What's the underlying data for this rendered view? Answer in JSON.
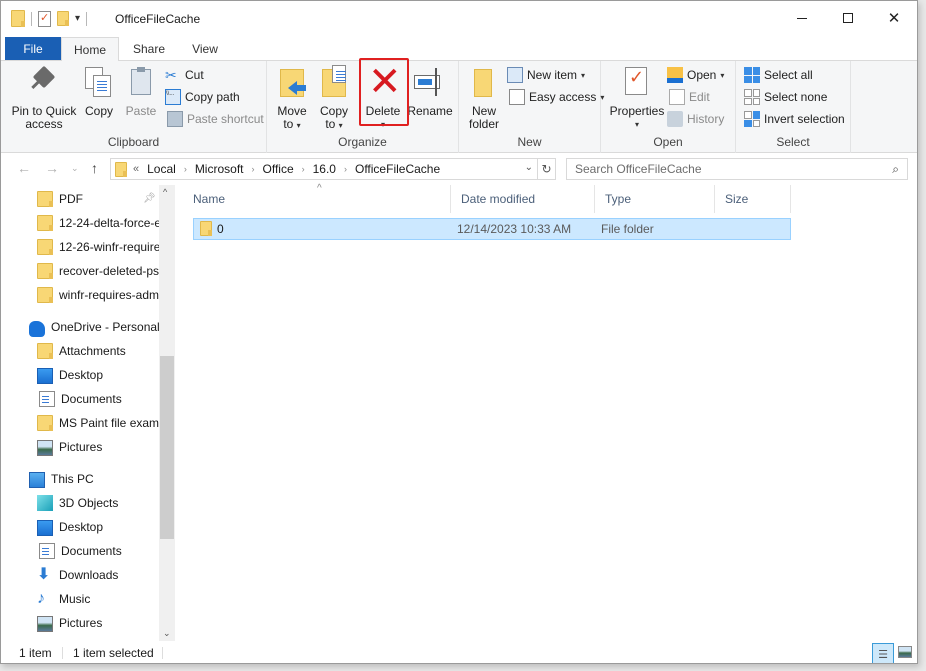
{
  "window": {
    "title": "OfficeFileCache",
    "controls": {
      "minimize": "minimize",
      "maximize": "maximize",
      "close": "✕"
    }
  },
  "tabs": [
    {
      "label": "File"
    },
    {
      "label": "Home"
    },
    {
      "label": "Share"
    },
    {
      "label": "View"
    }
  ],
  "ribbon": {
    "clipboard": {
      "label": "Clipboard",
      "pin": "Pin to Quick access",
      "pin_line1": "Pin to Quick",
      "pin_line2": "access",
      "copy": "Copy",
      "paste": "Paste",
      "cut": "Cut",
      "copy_path": "Copy path",
      "paste_shortcut": "Paste shortcut"
    },
    "organize": {
      "label": "Organize",
      "move_to_line1": "Move",
      "move_to_line2": "to",
      "copy_to_line1": "Copy",
      "copy_to_line2": "to",
      "delete": "Delete",
      "rename": "Rename"
    },
    "new": {
      "label": "New",
      "new_folder_line1": "New",
      "new_folder_line2": "folder",
      "new_item": "New item",
      "easy_access": "Easy access"
    },
    "open": {
      "label": "Open",
      "properties": "Properties",
      "open": "Open",
      "edit": "Edit",
      "history": "History"
    },
    "select": {
      "label": "Select",
      "select_all": "Select all",
      "select_none": "Select none",
      "invert_selection": "Invert selection"
    }
  },
  "address": {
    "overflow": "«",
    "crumbs": [
      "Local",
      "Microsoft",
      "Office",
      "16.0",
      "OfficeFileCache"
    ],
    "search_placeholder": "Search OfficeFileCache"
  },
  "nav_pane": {
    "quick_access": [
      {
        "label": "PDF",
        "pinned": true
      },
      {
        "label": "12-24-delta-force-e"
      },
      {
        "label": "12-26-winfr-require"
      },
      {
        "label": "recover-deleted-ps"
      },
      {
        "label": "winfr-requires-adm"
      }
    ],
    "onedrive": {
      "label": "OneDrive - Personal",
      "items": [
        {
          "label": "Attachments",
          "icon": "folder"
        },
        {
          "label": "Desktop",
          "icon": "desktop"
        },
        {
          "label": "Documents",
          "icon": "documents"
        },
        {
          "label": "MS Paint file examp",
          "icon": "folder"
        },
        {
          "label": "Pictures",
          "icon": "pictures"
        }
      ]
    },
    "this_pc": {
      "label": "This PC",
      "items": [
        {
          "label": "3D Objects",
          "icon": "3d-objects"
        },
        {
          "label": "Desktop",
          "icon": "desktop"
        },
        {
          "label": "Documents",
          "icon": "documents"
        },
        {
          "label": "Downloads",
          "icon": "downloads"
        },
        {
          "label": "Music",
          "icon": "music"
        },
        {
          "label": "Pictures",
          "icon": "pictures"
        }
      ]
    }
  },
  "file_list": {
    "columns": [
      "Name",
      "Date modified",
      "Type",
      "Size"
    ],
    "rows": [
      {
        "name": "0",
        "date_modified": "12/14/2023 10:33 AM",
        "type": "File folder",
        "size": "",
        "selected": true
      }
    ]
  },
  "status": {
    "item_count": "1 item",
    "selection": "1 item selected"
  },
  "colors": {
    "file_tab": "#1a5fb4",
    "selection_bg": "#cce8ff",
    "selection_border": "#99d1ff",
    "delete_highlight": "#e02020",
    "delete_icon": "#d71920"
  }
}
